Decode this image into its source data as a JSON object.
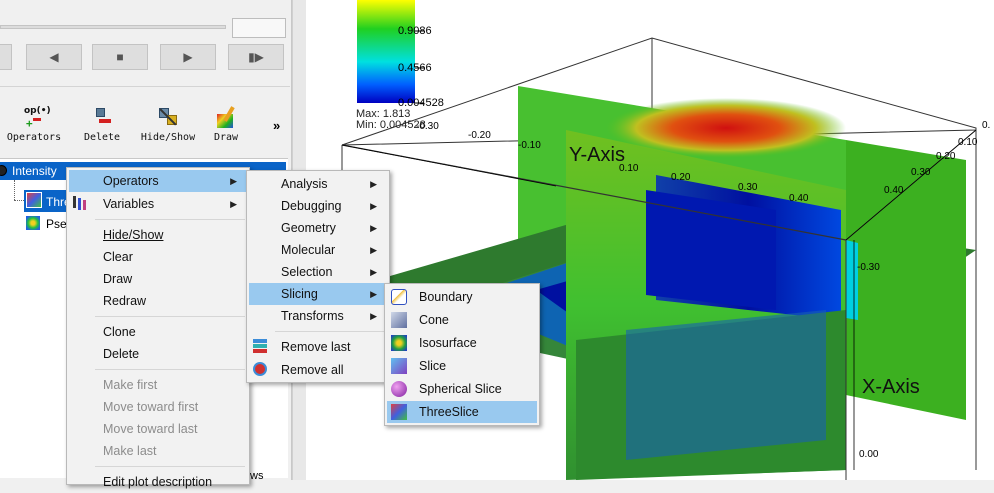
{
  "toolbar": {
    "time_buttons": [
      "",
      "◀",
      "■",
      "▶",
      "▮▶"
    ],
    "plot_tools": [
      {
        "label": "Operators",
        "icon": "operators-icon"
      },
      {
        "label": "Delete",
        "icon": "delete-icon"
      },
      {
        "label": "Hide/Show",
        "icon": "hide-show-icon"
      },
      {
        "label": "Draw",
        "icon": "draw-icon"
      }
    ],
    "more": "»"
  },
  "plot_list": {
    "row0": "Intensity",
    "row1": "Thre",
    "row2": "Pse",
    "partial_text": "ws"
  },
  "context_menu": {
    "items": [
      "Operators",
      "Variables",
      "Hide/Show",
      "Clear",
      "Draw",
      "Redraw",
      "Clone",
      "Delete",
      "Make first",
      "Move toward first",
      "Move toward last",
      "Make last",
      "Edit plot description"
    ]
  },
  "operators_menu": {
    "items": [
      "Analysis",
      "Debugging",
      "Geometry",
      "Molecular",
      "Selection",
      "Slicing",
      "Transforms",
      "Remove last",
      "Remove all"
    ]
  },
  "slicing_menu": {
    "items": [
      "Boundary",
      "Cone",
      "Isosurface",
      "Slice",
      "Spherical Slice",
      "ThreeSlice"
    ]
  },
  "legend": {
    "ticks": [
      "0.9086",
      "0.4566",
      "0.004528"
    ],
    "max": "Max: 1.813",
    "min": "Min: 0.004528"
  },
  "axes": {
    "y_title": "Y-Axis",
    "x_title": "X-Axis",
    "top_ticks": [
      "-0.30",
      "-0.20",
      "-0.10",
      "0.10",
      "0.20",
      "0.30",
      "0.40"
    ],
    "right_top_ticks": [
      "0.10",
      "0.20",
      "0.30",
      "0.40"
    ],
    "right_ticks": [
      "-0.30",
      "0.00"
    ],
    "partial": "0."
  }
}
